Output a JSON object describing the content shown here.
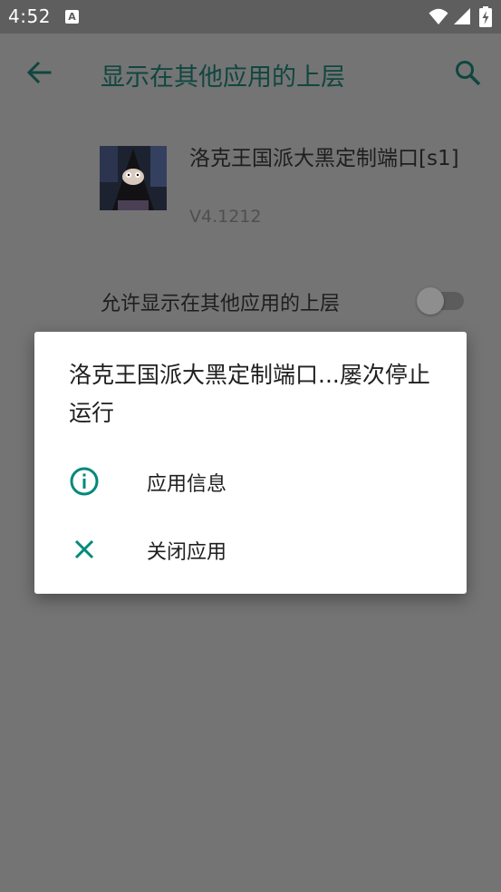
{
  "status_bar": {
    "time": "4:52",
    "notification_icon": "a-icon",
    "icons": [
      "wifi-icon",
      "signal-icon",
      "battery-charging-icon"
    ]
  },
  "app_bar": {
    "title": "显示在其他应用的上层",
    "back_icon": "arrow-back-icon",
    "search_icon": "search-icon"
  },
  "app_info": {
    "name": "洛克王国派大黑定制端口[s1]",
    "version": "V4.1212"
  },
  "permission": {
    "label": "允许显示在其他应用的上层",
    "enabled": false
  },
  "dialog": {
    "title": "洛克王国派大黑定制端口...屡次停止运行",
    "options": [
      {
        "label": "应用信息",
        "icon": "info-icon"
      },
      {
        "label": "关闭应用",
        "icon": "close-icon"
      }
    ]
  },
  "colors": {
    "accent": "#00897b",
    "scrim_background": "#747474",
    "status_bar": "#5e5e5e",
    "dialog_background": "#ffffff"
  }
}
